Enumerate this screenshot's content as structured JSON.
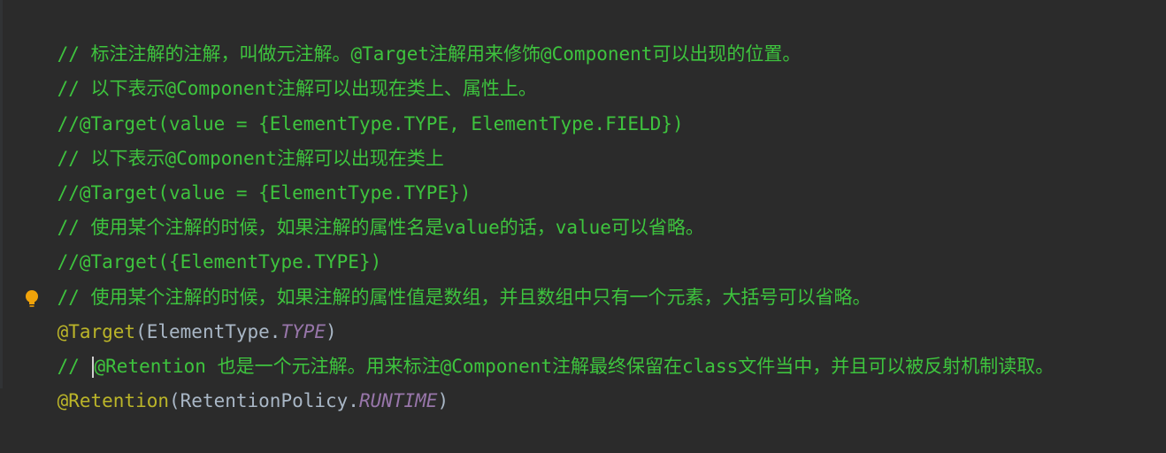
{
  "editor": {
    "lines": [
      {
        "type": "comment",
        "text": "// 标注注解的注解，叫做元注解。@Target注解用来修饰@Component可以出现的位置。"
      },
      {
        "type": "comment",
        "text": "// 以下表示@Component注解可以出现在类上、属性上。"
      },
      {
        "type": "comment",
        "text": "//@Target(value = {ElementType.TYPE, ElementType.FIELD})"
      },
      {
        "type": "comment",
        "text": "// 以下表示@Component注解可以出现在类上"
      },
      {
        "type": "comment",
        "text": "//@Target(value = {ElementType.TYPE})"
      },
      {
        "type": "comment",
        "text": "// 使用某个注解的时候，如果注解的属性名是value的话，value可以省略。"
      },
      {
        "type": "comment",
        "text": "//@Target({ElementType.TYPE})"
      },
      {
        "type": "comment",
        "text": "// 使用某个注解的时候，如果注解的属性值是数组，并且数组中只有一个元素，大括号可以省略。"
      }
    ],
    "target_line": {
      "annotation": "@Target",
      "open": "(ElementType.",
      "constant": "TYPE",
      "close": ")"
    },
    "retention_comment": {
      "prefix": "// ",
      "text": "@Retention 也是一个元注解。用来标注@Component注解最终保留在class文件当中，并且可以被反射机制读取。"
    },
    "retention_line": {
      "annotation": "@Retention",
      "open": "(RetentionPolicy.",
      "constant": "RUNTIME",
      "close": ")"
    },
    "colors": {
      "background": "#2b2b2b",
      "comment": "#3ec43e",
      "annotation": "#bbb529",
      "plain": "#a9b7c6",
      "constant": "#9876aa",
      "bulb": "#f0a30a"
    },
    "icons": {
      "intention": "lightbulb-icon"
    }
  }
}
